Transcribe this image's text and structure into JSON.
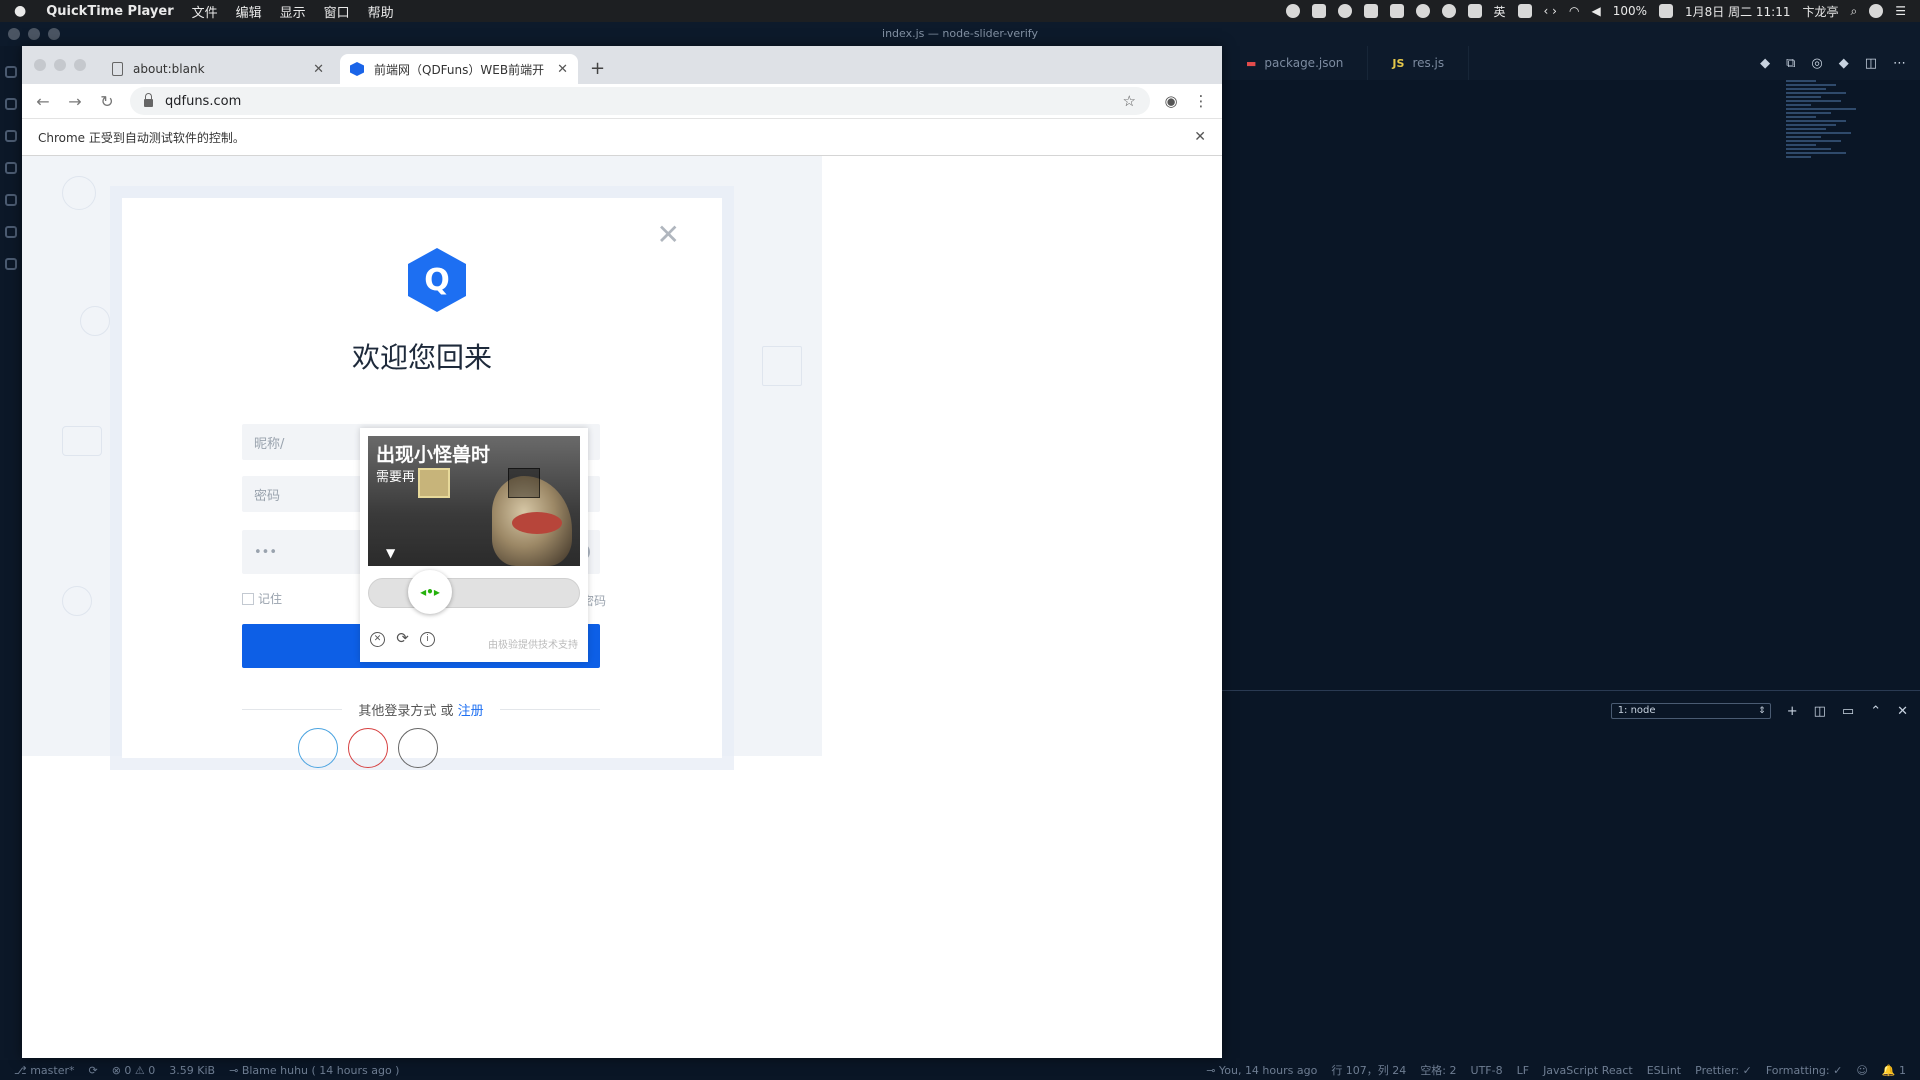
{
  "menubar": {
    "app": "QuickTime Player",
    "menus": [
      "文件",
      "编辑",
      "显示",
      "窗口",
      "帮助"
    ],
    "ime": "英",
    "battery": "100%",
    "datetime": "1月8日 周二 11:11",
    "user": "卞龙亭"
  },
  "vscode": {
    "title": "index.js — node-slider-verify",
    "tabs": [
      {
        "label": "package.json",
        "icon": "json-icon"
      },
      {
        "label": "res.js",
        "icon": "js-icon",
        "icon_text": "JS"
      }
    ],
    "terminal_select": "1: node",
    "status": {
      "branch": "master*",
      "problems_errors": "0",
      "problems_warnings": "0",
      "size": "3.59 KiB",
      "blame": "Blame huhu ( 14 hours ago )",
      "author": "You, 14 hours ago",
      "position": "行 107，列 24",
      "spaces": "空格: 2",
      "encoding": "UTF-8",
      "eol": "LF",
      "language": "JavaScript React",
      "eslint": "ESLint",
      "prettier": "Prettier: ✓",
      "formatting": "Formatting: ✓",
      "notifications": "1"
    }
  },
  "chrome": {
    "tabs": [
      {
        "title": "about:blank"
      },
      {
        "title": "前端网（QDFuns）WEB前端开"
      }
    ],
    "url": "qdfuns.com",
    "infobar": "Chrome 正受到自动测试软件的控制。"
  },
  "login": {
    "logo_letter": "Q",
    "welcome": "欢迎您回来",
    "nickname_placeholder": "昵称/",
    "password_placeholder": "密码",
    "captcha_placeholder": "•••",
    "remember": "记住",
    "forgot": "记密码",
    "other_text": "其他登录方式 或",
    "register": "注册"
  },
  "captcha": {
    "headline": "出现小怪兽时",
    "subline": "需要再          次哦",
    "brand": "由极验提供技术支持",
    "handle_glyph": "◂•▸",
    "slider_position": 0.2
  }
}
